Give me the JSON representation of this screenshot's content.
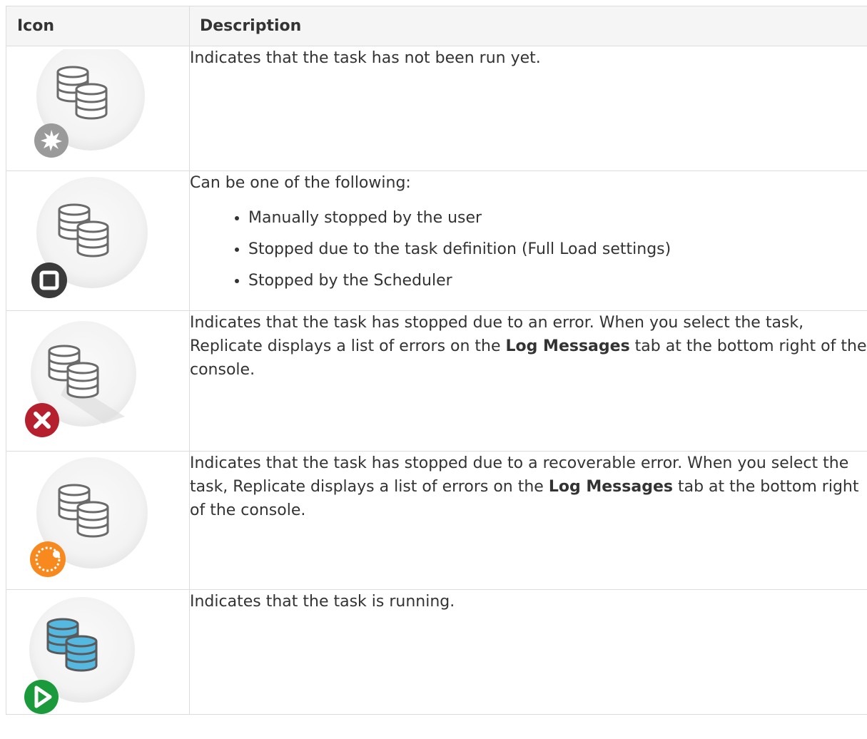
{
  "table": {
    "headers": {
      "icon": "Icon",
      "description": "Description"
    },
    "rows": [
      {
        "icon": "not-run-task-icon",
        "text": "Indicates that the task has not been run yet."
      },
      {
        "icon": "stopped-task-icon",
        "intro": "Can be one of the following:",
        "bullets": [
          "Manually stopped by the user",
          "Stopped due to the task definition (Full Load settings)",
          "Stopped by the Scheduler"
        ]
      },
      {
        "icon": "error-task-icon",
        "before": "Indicates that the task has stopped due to an error. When you select the task, Replicate displays a list of errors on the ",
        "bold": "Log Messages",
        "after": " tab at the bottom right of the console."
      },
      {
        "icon": "recoverable-error-task-icon",
        "before": "Indicates that the task has stopped due to a recoverable error. When you select the task, Replicate displays a list of errors on the ",
        "bold": "Log Messages",
        "after": " tab at the bottom right of the console."
      },
      {
        "icon": "running-task-icon",
        "text": "Indicates that the task is running."
      }
    ]
  },
  "colors": {
    "db_gray": "#6b6b6b",
    "db_blue": "#54b8e0",
    "error_red": "#b51f2e",
    "recoverable_orange": "#f7891f",
    "running_green": "#1a9a3a",
    "stopped_dark": "#3a3a3a",
    "not_run_gray": "#9a9a9a"
  }
}
